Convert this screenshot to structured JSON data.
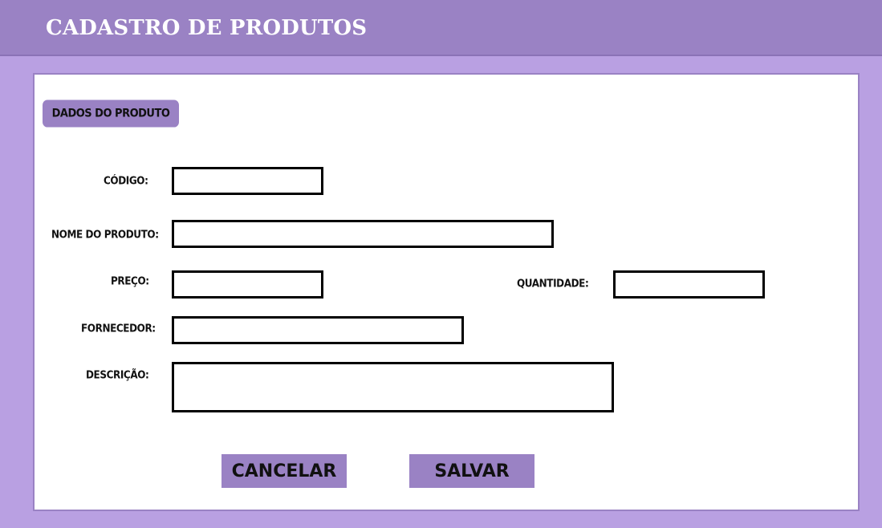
{
  "header": {
    "title": "CADASTRO DE PRODUTOS"
  },
  "form": {
    "section_title": "DADOS DO PRODUTO",
    "fields": {
      "codigo": {
        "label": "CÓDIGO:",
        "value": ""
      },
      "nome": {
        "label": "NOME DO PRODUTO:",
        "value": ""
      },
      "preco": {
        "label": "PREÇO:",
        "value": ""
      },
      "quantidade": {
        "label": "QUANTIDADE:",
        "value": ""
      },
      "fornecedor": {
        "label": "FORNECEDOR:",
        "value": ""
      },
      "descricao": {
        "label": "DESCRIÇÃO:",
        "value": ""
      }
    }
  },
  "buttons": {
    "cancel": "CANCELAR",
    "save": "SALVAR"
  },
  "colors": {
    "header_bg": "#9a82c4",
    "page_bg": "#b9a0e2",
    "panel_bg": "#ffffff",
    "button_bg": "#9a82c4",
    "field_border": "#000000"
  }
}
